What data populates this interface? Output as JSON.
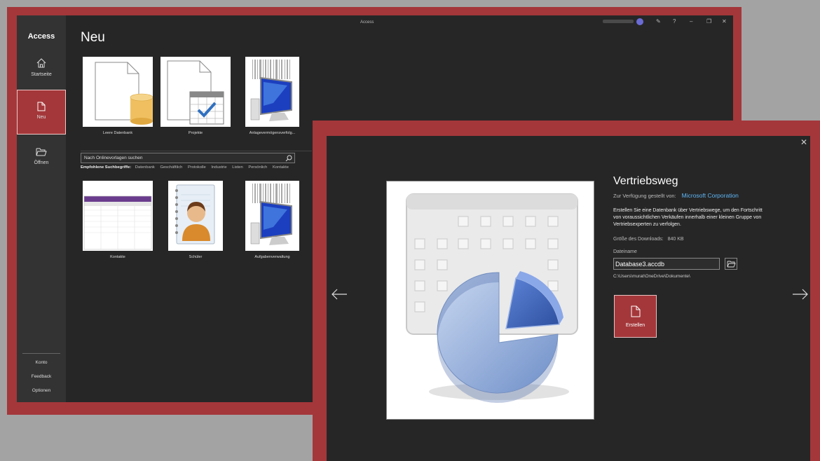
{
  "window1": {
    "titlebar": "Access",
    "sidebar": {
      "app_name": "Access",
      "items": [
        {
          "label": "Startseite",
          "icon": "home-icon"
        },
        {
          "label": "Neu",
          "icon": "new-file-icon"
        },
        {
          "label": "Öffnen",
          "icon": "folder-open-icon"
        }
      ],
      "bottom": [
        "Konto",
        "Feedback",
        "Optionen"
      ]
    },
    "page_title": "Neu",
    "templates_top": [
      {
        "label": "Leere Datenbank"
      },
      {
        "label": "Projekte"
      },
      {
        "label": "Anlagevermögensverfolg..."
      }
    ],
    "search": {
      "placeholder": "Nach Onlinevorlagen suchen"
    },
    "suggestions": {
      "label": "Empfohlene Suchbegriffe:",
      "terms": [
        "Datenbank",
        "Geschäftlich",
        "Protokolle",
        "Industrie",
        "Listen",
        "Persönlich",
        "Kontakte"
      ]
    },
    "templates_bottom": [
      {
        "label": "Kontakte"
      },
      {
        "label": "Schüler"
      },
      {
        "label": "Aufgabenverwaltung"
      }
    ],
    "controls": {
      "help": "?",
      "minimize": "–",
      "restore": "❐",
      "close": "✕"
    }
  },
  "dialog": {
    "title": "Vertriebsweg",
    "provided_by_label": "Zur Verfügung gestellt von:",
    "provider": "Microsoft Corporation",
    "description": "Erstellen Sie eine Datenbank über Vertriebswege, um den Fortschritt von voraussichtlichen Verkäufen innerhalb einer kleinen Gruppe von Vertriebsexperten zu verfolgen.",
    "size_label": "Größe des Downloads:",
    "size_value": "840 KB",
    "filename_label": "Dateiname",
    "filename_value": "Database3.accdb",
    "path": "C:\\Users\\murat\\OneDrive\\Dokumente\\",
    "create_label": "Erstellen",
    "close": "✕"
  },
  "colors": {
    "accent": "#a4373a",
    "link": "#5fb6f5",
    "bg": "#262626"
  }
}
